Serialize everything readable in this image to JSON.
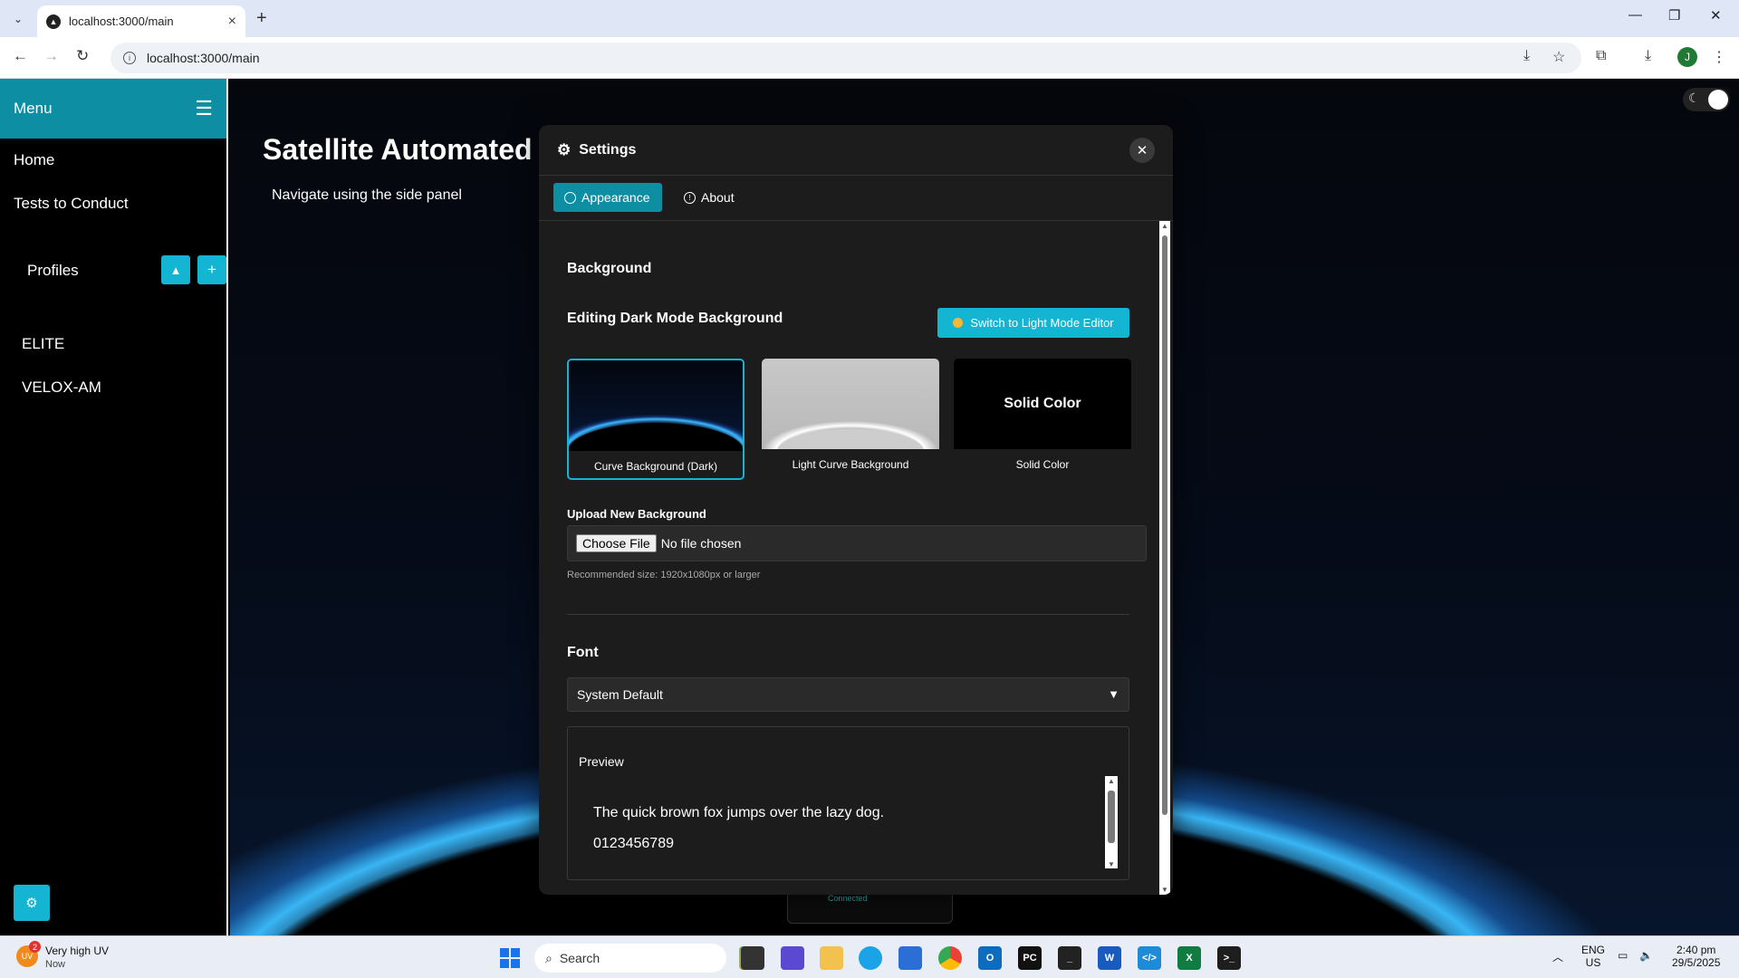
{
  "browser": {
    "tab_title": "localhost:3000/main",
    "url": "localhost:3000/main",
    "profile_initial": "J"
  },
  "sidebar": {
    "title": "Menu",
    "links": [
      "Home",
      "Tests to Conduct"
    ],
    "profiles_label": "Profiles",
    "profiles": [
      "ELITE",
      "VELOX-AM"
    ]
  },
  "main": {
    "title": "Satellite Automated",
    "subtitle": "Navigate using the side panel",
    "connected": "Connected"
  },
  "settings": {
    "title": "Settings",
    "tabs": [
      "Appearance",
      "About"
    ],
    "active_tab": "Appearance",
    "background_heading": "Background",
    "editing_heading": "Editing Dark Mode Background",
    "switch_button": "Switch to Light Mode Editor",
    "bg_options": [
      {
        "caption": "Curve Background (Dark)",
        "selected": true
      },
      {
        "caption": "Light Curve Background",
        "selected": false
      },
      {
        "caption": "Solid Color",
        "label": "Solid Color",
        "selected": false
      }
    ],
    "upload_label": "Upload New Background",
    "choose_file": "Choose File",
    "no_file": "No file chosen",
    "recommended": "Recommended size: 1920x1080px or larger",
    "font_heading": "Font",
    "font_selected": "System Default",
    "preview_title": "Preview",
    "preview_text": "The quick brown fox jumps over the lazy dog.",
    "preview_digits": "0123456789"
  },
  "taskbar": {
    "weather_title": "Very high UV",
    "weather_sub": "Now",
    "weather_badge": "2",
    "weather_icon_text": "UV",
    "search_placeholder": "Search",
    "lang": "ENG",
    "region": "US",
    "time": "2:40 pm",
    "date": "29/5/2025"
  },
  "colors": {
    "accent": "#13b5d3",
    "sidebar_header": "#0e8ea3",
    "modal_bg": "#1c1c1c"
  }
}
